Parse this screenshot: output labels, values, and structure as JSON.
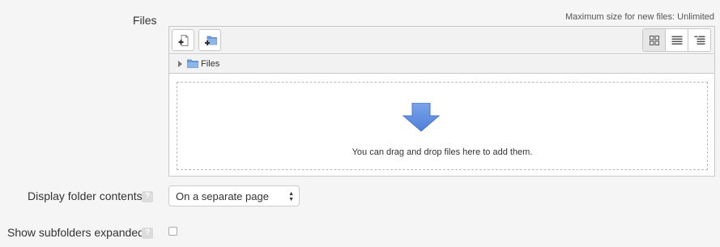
{
  "files": {
    "label": "Files",
    "max_size": "Maximum size for new files: Unlimited",
    "toolbar": {
      "add_icon": "add-file-icon",
      "create_folder_icon": "create-folder-icon",
      "views": [
        "icons-view",
        "list-view",
        "tree-view"
      ],
      "active_view": "icons-view"
    },
    "path": "Files",
    "drop_text": "You can drag and drop files here to add them."
  },
  "display_folder": {
    "label": "Display folder contents",
    "help_icon": "?",
    "selected": "On a separate page"
  },
  "subfolders": {
    "label": "Show subfolders expanded",
    "help_icon": "?",
    "checked": false
  },
  "colors": {
    "accent": "#5b8ae3",
    "page_bg": "#f5f5f5"
  }
}
